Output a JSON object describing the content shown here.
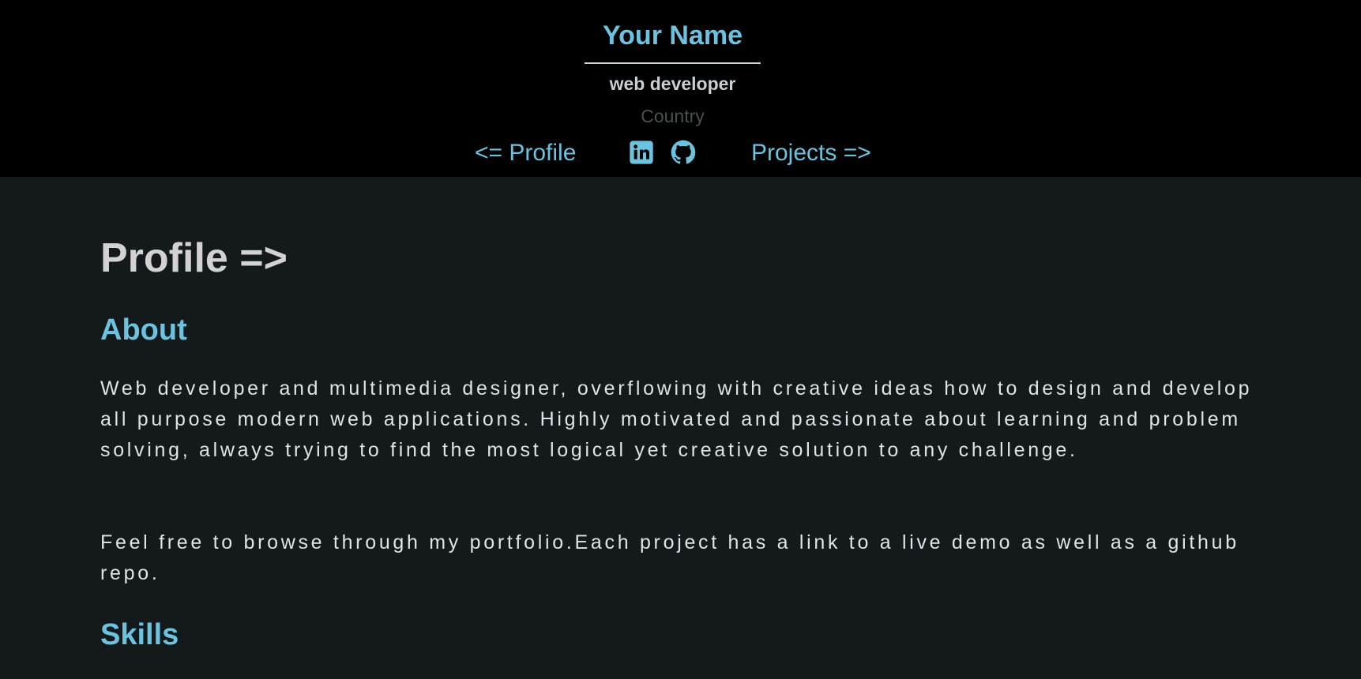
{
  "header": {
    "name": "Your Name",
    "role": "web developer",
    "country": "Country",
    "nav": {
      "prev_label": "<= Profile",
      "next_label": "Projects =>"
    },
    "social": [
      {
        "icon": "linkedin-icon"
      },
      {
        "icon": "github-icon"
      }
    ]
  },
  "main": {
    "section_title": "Profile =>",
    "about": {
      "title": "About",
      "paragraph_1": "Web developer and multimedia designer, overflowing with creative ideas how to design and develop all purpose modern web applications. Highly motivated and passionate about learning and problem solving, always trying to find the most logical yet creative solution to any challenge.",
      "paragraph_2": "Feel free to browse through my portfolio.Each project has a link to a live demo as well as a github repo."
    },
    "skills": {
      "title": "Skills"
    }
  },
  "colors": {
    "accent": "#6cc3e0",
    "header_bg": "#000000",
    "page_bg": "#141a1c",
    "text": "#dfe3e5",
    "muted": "#4a4f52"
  }
}
